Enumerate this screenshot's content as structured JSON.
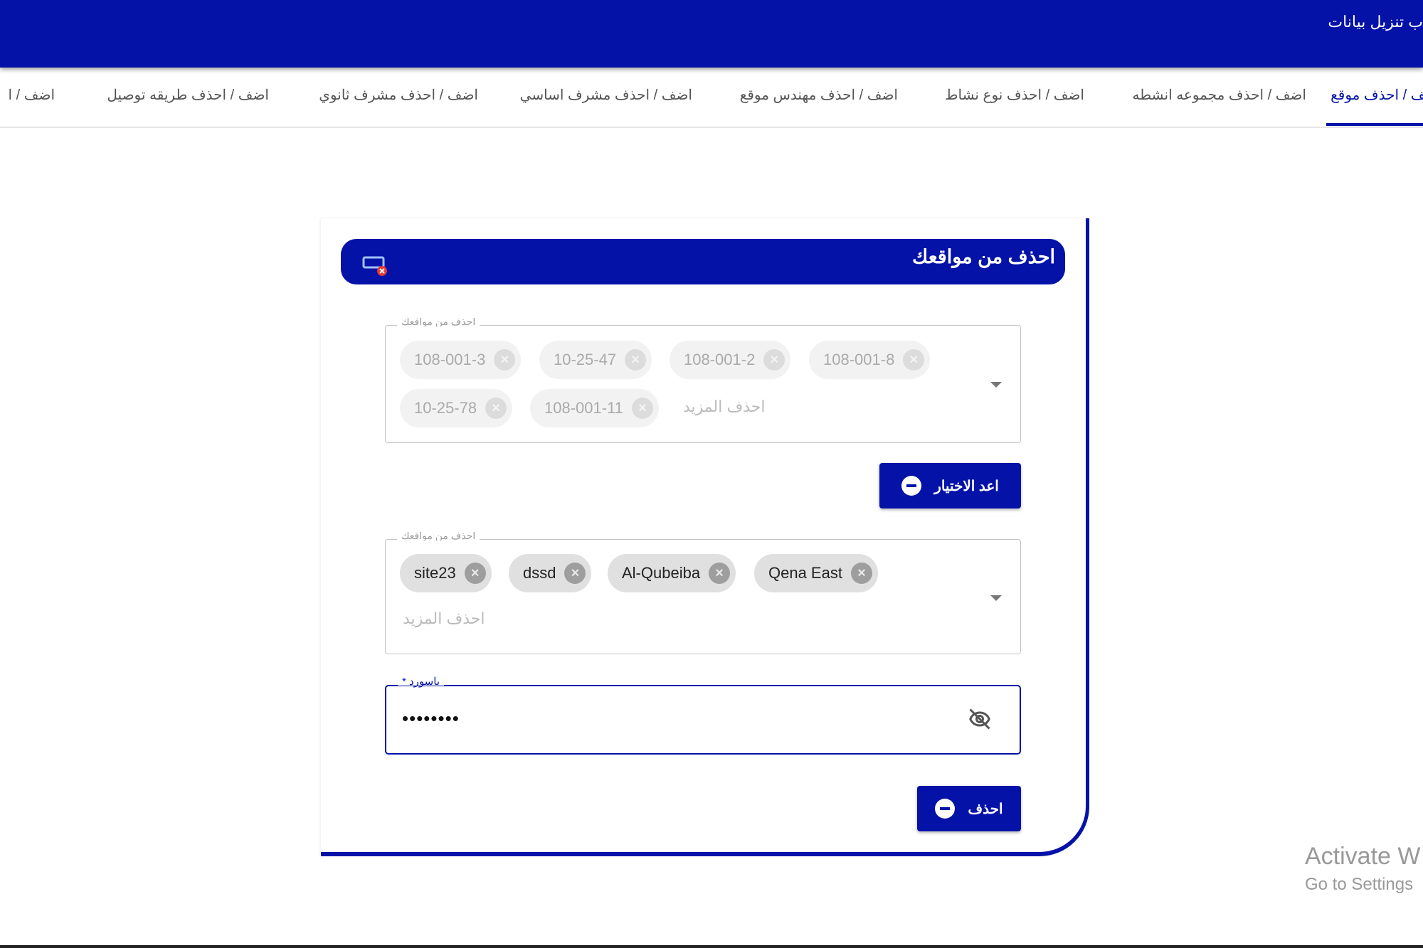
{
  "topbar": {
    "title": "ب تنزيل بيانات"
  },
  "tabs": [
    {
      "label": "اضف / احذف موقع",
      "active": true
    },
    {
      "label": "اضف / احذف مجموعه انشطه"
    },
    {
      "label": "اضف / احذف نوع نشاط"
    },
    {
      "label": "اضف / احذف مهندس موقع"
    },
    {
      "label": "اضف / احذف مشرف اساسي"
    },
    {
      "label": "اضف / احذف مشرف ثانوي"
    },
    {
      "label": "اضف / احذف طريقه توصيل"
    },
    {
      "label": "اضف / ا"
    }
  ],
  "card": {
    "title": "احذف من مواقعك",
    "select1": {
      "label": "احذف من مواقعك",
      "placeholder": "احذف المزيد",
      "chips": [
        "108-001-3",
        "10-25-47",
        "108-001-2",
        "108-001-8",
        "10-25-78",
        "108-001-11"
      ]
    },
    "reset_button": "اعد الاختيار",
    "select2": {
      "label": "احذف من مواقعك",
      "placeholder": "احذف المزيد",
      "chips": [
        "site23",
        "dssd",
        "Al-Qubeiba",
        "Qena East"
      ]
    },
    "password": {
      "label": "باسورد *",
      "value": "••••••••"
    },
    "delete_button": "احذف"
  },
  "watermark": {
    "line1": "Activate W",
    "line2": "Go to Settings"
  },
  "colors": {
    "primary": "#0412a8"
  }
}
